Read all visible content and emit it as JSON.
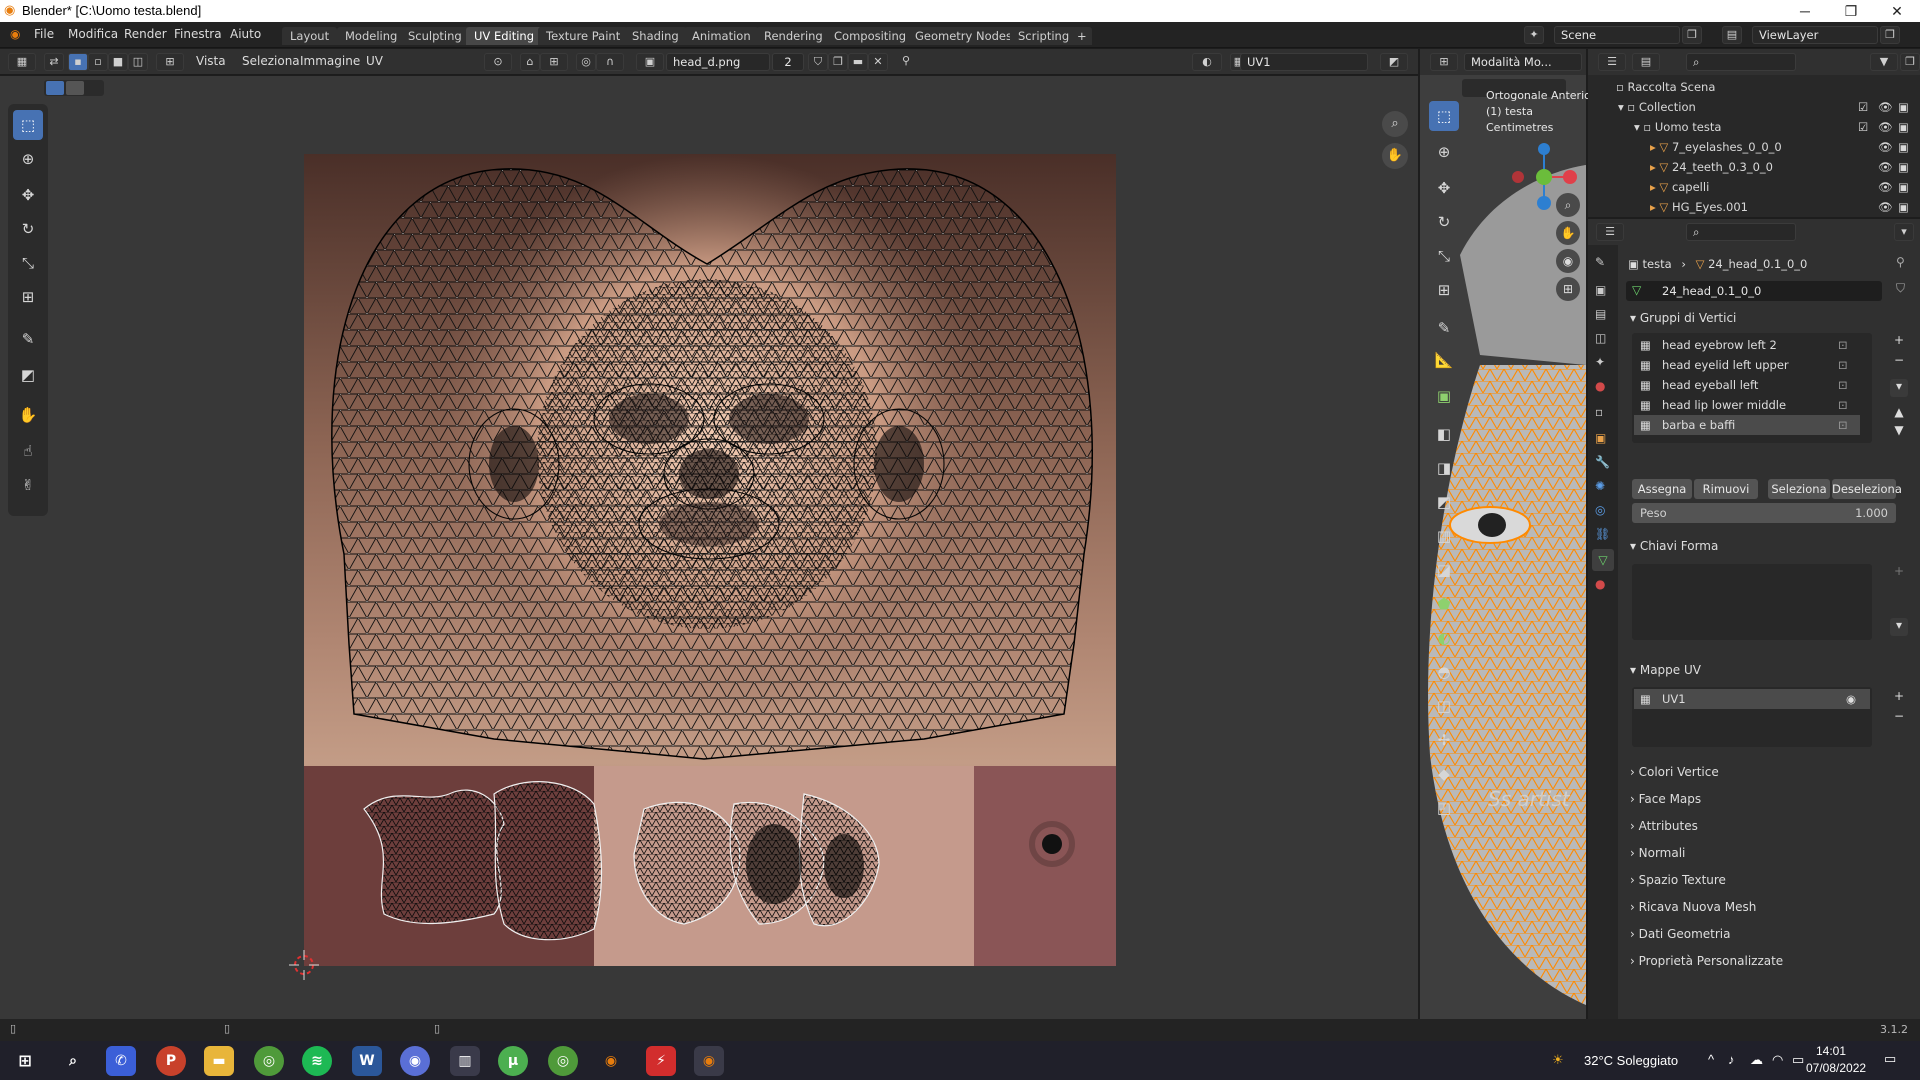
{
  "window": {
    "title": "Blender* [C:\\Uomo testa.blend]",
    "minimize": "─",
    "restore": "❐",
    "close": "✕"
  },
  "menu": [
    "File",
    "Modifica",
    "Render",
    "Finestra",
    "Aiuto"
  ],
  "workspaces": [
    "Layout",
    "Modeling",
    "Sculpting",
    "UV Editing",
    "Texture Paint",
    "Shading",
    "Animation",
    "Rendering",
    "Compositing",
    "Geometry Nodes",
    "Scripting"
  ],
  "workspace_add": "+",
  "active_workspace": "UV Editing",
  "scene": {
    "label": "Scene",
    "viewlayer": "ViewLayer"
  },
  "uv_editor": {
    "menu": [
      "Vista",
      "Seleziona",
      "Immagine",
      "UV"
    ],
    "image_name": "head_d.png",
    "image_users": "2",
    "uv_map": "UV1"
  },
  "viewport3d": {
    "mode": "Modalità Mo...",
    "view_name": "Ortogonale Anteriore",
    "object_label": "(1) testa",
    "units": "Centimetres",
    "watermark": "Ss artist"
  },
  "outliner": {
    "root": "Raccolta Scena",
    "collection": "Collection",
    "object": "Uomo testa",
    "children": [
      "7_eyelashes_0_0_0",
      "24_teeth_0.3_0_0",
      "capelli",
      "HG_Eyes.001"
    ]
  },
  "properties": {
    "breadcrumb_object": "testa",
    "breadcrumb_mesh": "24_head_0.1_0_0",
    "mesh_name": "24_head_0.1_0_0",
    "vertex_groups_title": "Gruppi di Vertici",
    "vertex_groups": [
      "head eyebrow left 2",
      "head eyelid left upper",
      "head eyeball left",
      "head lip lower middle",
      "barba e baffi"
    ],
    "selected_group": "barba e baffi",
    "buttons": [
      "Assegna",
      "Rimuovi",
      "Seleziona",
      "Deseleziona"
    ],
    "weight_label": "Peso",
    "weight_value": "1.000",
    "shape_keys_title": "Chiavi Forma",
    "uv_maps_title": "Mappe UV",
    "uv_maps": [
      "UV1"
    ],
    "collapsed_sections": [
      "Colori Vertice",
      "Face Maps",
      "Attributes",
      "Normali",
      "Spazio Texture",
      "Ricava Nuova Mesh",
      "Dati Geometria",
      "Proprietà Personalizzate"
    ]
  },
  "statusbar": {
    "version": "3.1.2"
  },
  "taskbar": {
    "weather": "32°C  Soleggiato",
    "time": "14:01",
    "date": "07/08/2022"
  },
  "colors": {
    "accent": "#4772b3",
    "selection_orange": "#ff8a00",
    "blender_orange": "#e87d0d"
  }
}
